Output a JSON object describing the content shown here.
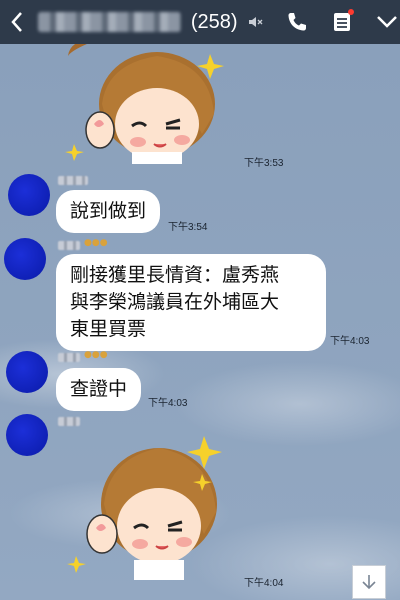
{
  "header": {
    "member_count": "(258)",
    "icons": [
      "back-icon",
      "mute-icon",
      "call-icon",
      "notes-icon",
      "chevron-down-icon"
    ]
  },
  "messages": [
    {
      "type": "sticker",
      "time": "下午3:53"
    },
    {
      "type": "text",
      "text": "說到做到",
      "time": "下午3:54"
    },
    {
      "type": "text",
      "lines": [
        "剛接獲里長情資：盧秀燕",
        "與李榮鴻議員在外埔區大",
        "東里買票"
      ],
      "time": "下午4:03"
    },
    {
      "type": "text",
      "text": "查證中",
      "time": "下午4:03"
    },
    {
      "type": "sticker",
      "time": "下午4:04"
    }
  ],
  "colors": {
    "header_bg": "#2e3a4a",
    "chat_bg": "#8ea3bd",
    "bubble_bg": "#ffffff",
    "avatar": "#1226c8"
  }
}
